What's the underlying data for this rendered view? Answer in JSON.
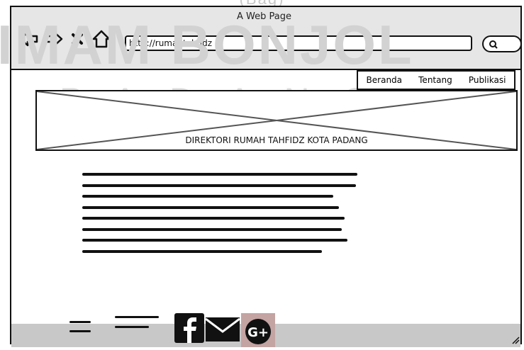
{
  "window": {
    "title": "A Web Page"
  },
  "address_bar": {
    "url": "http://rumahtahfidz"
  },
  "nav": {
    "items": [
      "Beranda",
      "Tentang",
      "Publikasi"
    ]
  },
  "banner": {
    "caption": "DIREKTORI RUMAH TAHFIDZ KOTA PADANG"
  },
  "watermark": {
    "top": "(Bag)",
    "big": "IMAM BONJOL",
    "small": "PADANG"
  },
  "footer": {
    "social": [
      "facebook-icon",
      "mail-icon",
      "google-plus-icon"
    ]
  }
}
